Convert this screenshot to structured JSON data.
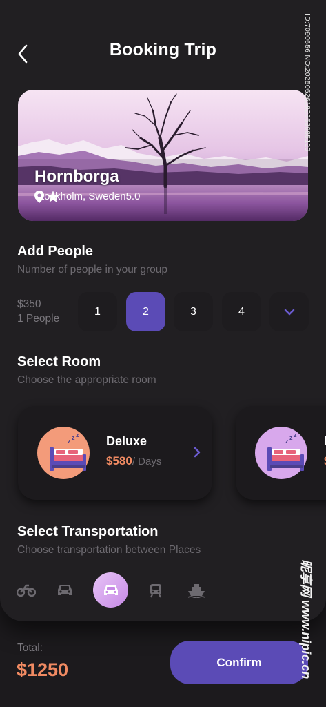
{
  "header": {
    "title": "Booking Trip",
    "back_icon": "chevron-left-icon"
  },
  "destination": {
    "name": "Hornborga",
    "location": "Stockholm, Sweden",
    "rating": "5.0",
    "location_icon": "map-pin-icon",
    "rating_icon": "star-icon"
  },
  "people": {
    "title": "Add People",
    "subtitle": "Number of people in your group",
    "price": "$350",
    "price_unit": "1 People",
    "options": [
      "1",
      "2",
      "3",
      "4"
    ],
    "selected": "2",
    "more_icon": "chevron-down-icon"
  },
  "rooms": {
    "title": "Select Room",
    "subtitle": "Choose the appropriate room",
    "items": [
      {
        "name": "Deluxe",
        "price": "$580",
        "per": "/ Days",
        "color": "#f39b7a",
        "icon": "bed-icon"
      },
      {
        "name": "L",
        "price": "$",
        "per": "",
        "color": "#d8a8ec",
        "icon": "bed-icon"
      }
    ]
  },
  "transport": {
    "title": "Select Transportation",
    "subtitle": "Choose transportation between Places",
    "options": [
      "motorcycle-icon",
      "car-icon",
      "taxi-icon",
      "train-icon",
      "ship-icon"
    ],
    "selected": "taxi-icon"
  },
  "footer": {
    "total_label": "Total:",
    "total_value": "$1250",
    "confirm_label": "Confirm"
  },
  "watermark": {
    "id_text": "ID:7090656 NO:20250626182353985129",
    "site_text": "昵享网 www.nipic.cn"
  },
  "colors": {
    "accent": "#5b4bb6",
    "price": "#f08a62",
    "background": "#1c1a1d"
  }
}
